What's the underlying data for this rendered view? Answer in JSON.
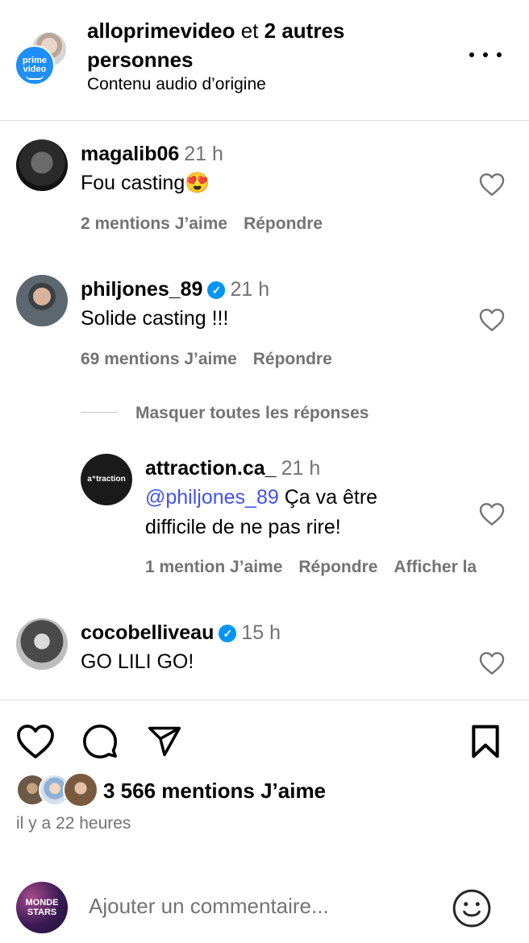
{
  "header": {
    "user": "alloprimevideo",
    "connector": " et ",
    "others": "2 autres personnes",
    "subtitle": "Contenu audio d’origine",
    "brand_top": "prime",
    "brand_bottom": "video"
  },
  "comments": [
    {
      "user": "magalib06",
      "verified": false,
      "time": "21 h",
      "text": "Fou casting😍",
      "likes": "2 mentions J’aime",
      "reply": "Répondre"
    },
    {
      "user": "philjones_89",
      "verified": true,
      "time": "21 h",
      "text": "Solide casting !!!",
      "likes": "69 mentions J’aime",
      "reply": "Répondre"
    },
    {
      "user": "cocobelliveau",
      "verified": true,
      "time": "15 h",
      "text": "GO LILI GO!"
    }
  ],
  "thread": {
    "hide_label": "Masquer toutes les réponses",
    "reply": {
      "user": "attraction.ca_",
      "time": "21 h",
      "mention": "@philjones_89",
      "text": " Ça va être difficile de ne pas rire!",
      "likes": "1 mention J’aime",
      "reply": "Répondre",
      "more": "Afficher la",
      "avatar_label": "a⁺traction"
    }
  },
  "post": {
    "likes": "3 566 mentions J’aime",
    "time_ago": "il y a 22 heures"
  },
  "composer": {
    "placeholder": "Ajouter un commentaire...",
    "avatar_label_1": "MONDE",
    "avatar_label_2": "STARS"
  },
  "icons": {
    "more": "more-horizontal-icon",
    "like": "heart-icon",
    "comment": "comment-icon",
    "share": "paper-plane-icon",
    "save": "bookmark-icon",
    "emoji": "smiley-icon",
    "verified": "verified-badge-icon"
  },
  "colors": {
    "verified": "#0095f6",
    "mention": "#4150f7",
    "secondary_text": "#737373",
    "brand_blue": "#1f8ff7"
  }
}
